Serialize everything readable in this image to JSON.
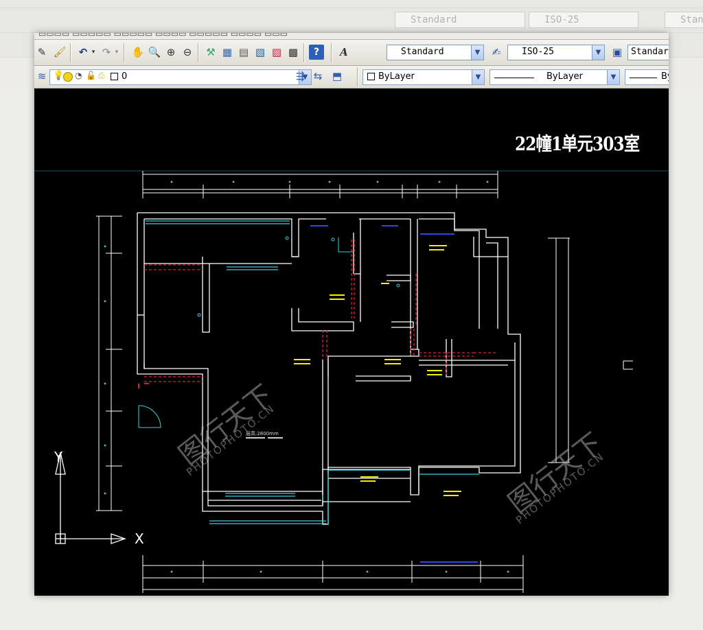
{
  "app": {
    "styles": {
      "text_style": "Standard",
      "dim_style": "ISO-25",
      "table_style": "Standard"
    },
    "layer": {
      "current": "0"
    },
    "properties": {
      "color": "ByLayer",
      "linetype": "ByLayer",
      "lineweight": "By"
    }
  },
  "drawing": {
    "title": "22幢1单元303室",
    "room_label": "层高:2800mm",
    "ucs_x": "X",
    "ucs_y": "Y"
  },
  "watermark": {
    "brand": "图行天下",
    "url": "PHOTOPHOTO.CN"
  },
  "colors": {
    "wall": "#ffffff",
    "window": "#3ccfe0",
    "dashed": "#e0202a",
    "annotation": "#f2f200",
    "dimension": "#ffffff",
    "canvas": "#000000"
  }
}
